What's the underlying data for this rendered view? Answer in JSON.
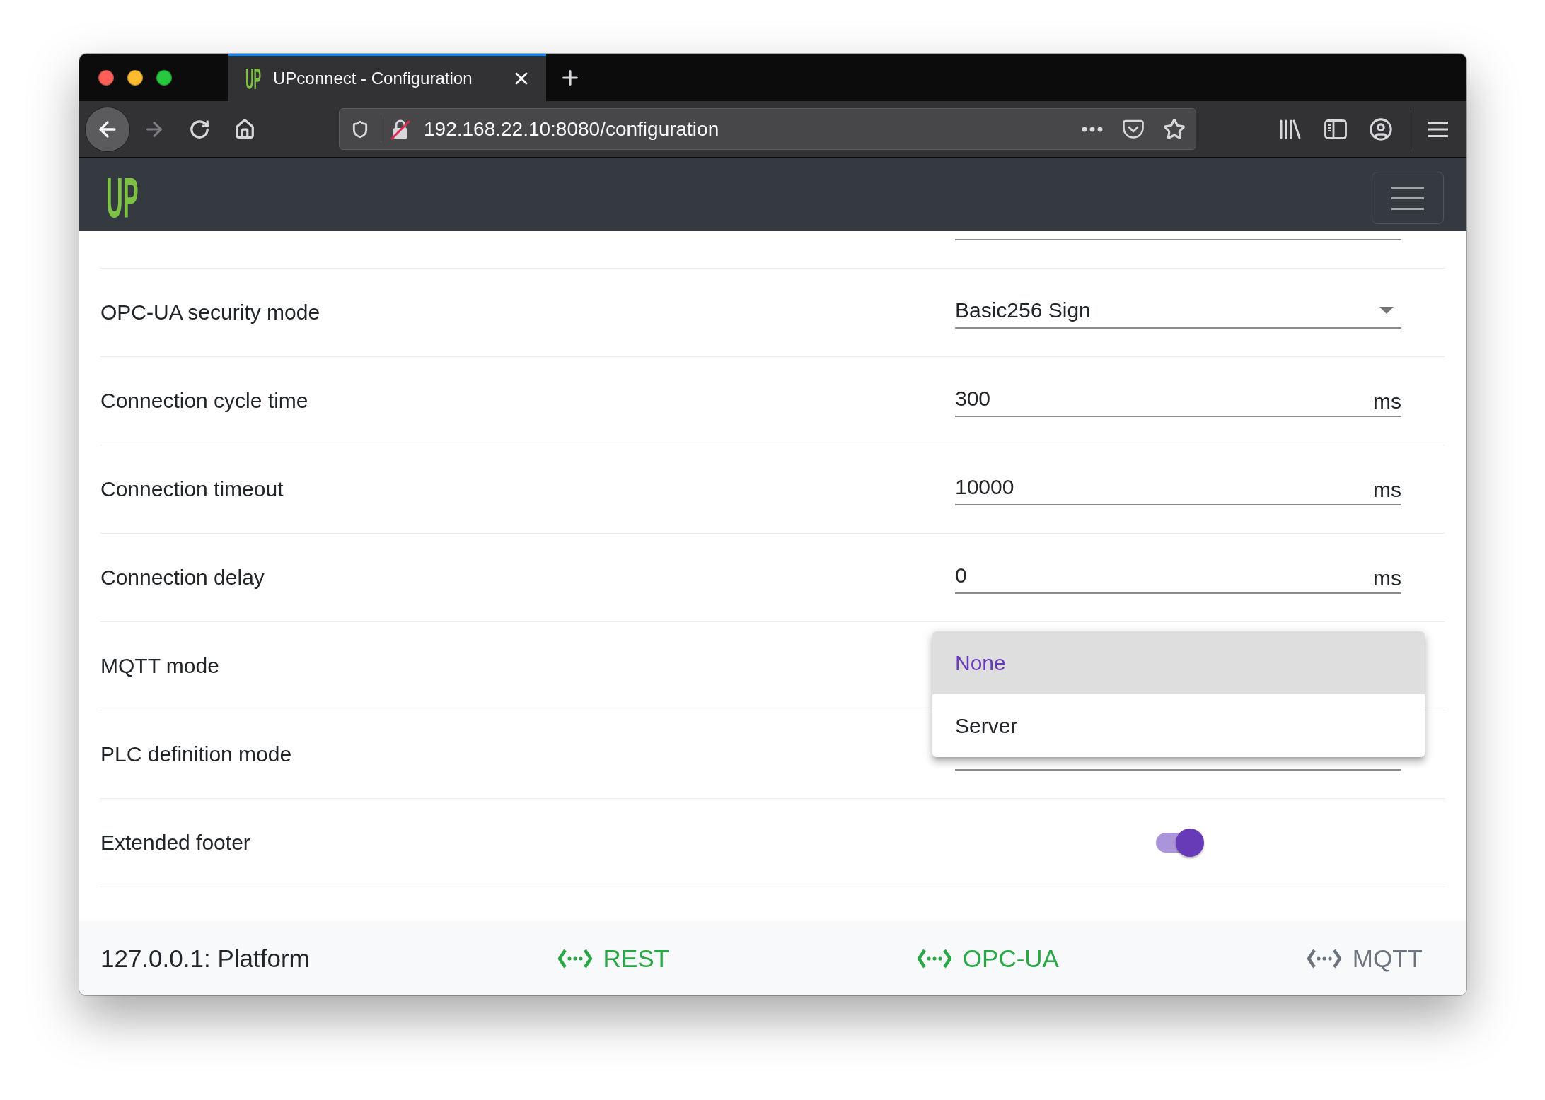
{
  "browser": {
    "tabs": [
      {
        "favicon": "UP",
        "title": "UPconnect - Configuration",
        "selected": true
      }
    ],
    "nav_buttons": [
      {
        "kind": "back",
        "disabled": false
      },
      {
        "kind": "forward",
        "disabled": true
      }
    ],
    "url": "192.168.22.10:8080/configuration"
  },
  "navbar": {
    "logo": "UP"
  },
  "settings": [
    {
      "kind": "text"
    },
    {
      "kind": "select",
      "label": "OPC-UA security mode",
      "value": "Basic256 Sign",
      "expanded": false
    },
    {
      "kind": "number",
      "label": "Connection cycle time",
      "value": "300",
      "unit": "ms"
    },
    {
      "kind": "number",
      "label": "Connection timeout",
      "value": "10000",
      "unit": "ms"
    },
    {
      "kind": "number",
      "label": "Connection delay",
      "value": "0",
      "unit": "ms"
    },
    {
      "kind": "select",
      "label": "MQTT mode",
      "expanded": true,
      "options": [
        {
          "label": "None",
          "selected": true
        },
        {
          "label": "Server",
          "selected": false
        }
      ]
    },
    {
      "kind": "select",
      "label": "PLC definition mode",
      "expanded": false
    },
    {
      "kind": "switch",
      "label": "Extended footer",
      "on": true
    }
  ],
  "footer": {
    "host": "127.0.0.1: Platform",
    "connections": [
      {
        "label": "REST",
        "connected": true
      },
      {
        "label": "OPC-UA",
        "connected": true
      },
      {
        "label": "MQTT",
        "connected": false
      }
    ]
  }
}
